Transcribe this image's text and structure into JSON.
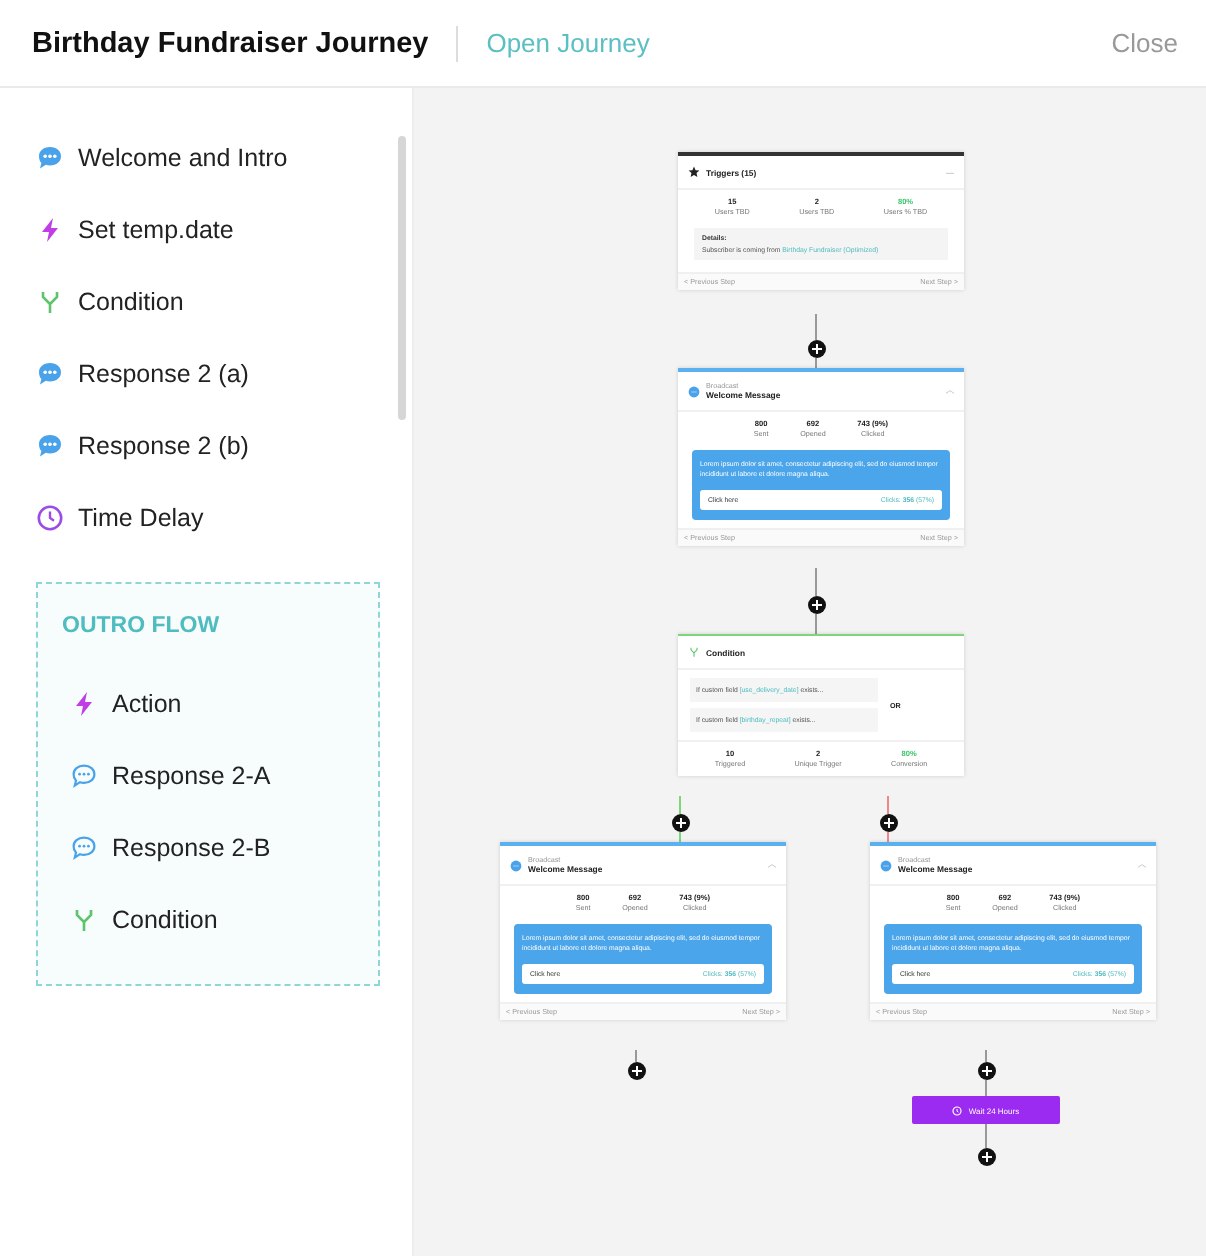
{
  "header": {
    "title": "Birthday Fundraiser Journey",
    "link": "Open Journey",
    "close": "Close"
  },
  "sidebar": {
    "items": [
      {
        "kind": "message",
        "label": "Welcome and Intro"
      },
      {
        "kind": "action",
        "label": "Set temp.date"
      },
      {
        "kind": "condition",
        "label": "Condition"
      },
      {
        "kind": "message",
        "label": "Response 2 (a)"
      },
      {
        "kind": "message",
        "label": "Response 2 (b)"
      },
      {
        "kind": "delay",
        "label": "Time Delay"
      }
    ],
    "outro": {
      "title": "OUTRO FLOW",
      "items": [
        {
          "kind": "action",
          "label": "Action"
        },
        {
          "kind": "response",
          "label": "Response 2-A"
        },
        {
          "kind": "response",
          "label": "Response 2-B"
        },
        {
          "kind": "condition",
          "label": "Condition"
        }
      ]
    }
  },
  "flow": {
    "steps": [
      {
        "kind": "trigger",
        "title": "Triggers (15)",
        "stats": [
          {
            "value": "15",
            "label": "Users TBD",
            "highlight": false
          },
          {
            "value": "2",
            "label": "Users TBD",
            "highlight": false
          },
          {
            "value": "80%",
            "label": "Users % TBD",
            "highlight": true
          }
        ],
        "details_label": "Details:",
        "details_text": "Subscriber is coming from",
        "details_link": "Birthday Fundraiser (Optimized)",
        "prev": "< Previous Step",
        "next": "Next Step >"
      },
      {
        "kind": "broadcast",
        "tag": "Broadcast",
        "title": "Welcome Message",
        "stats": [
          {
            "value": "800",
            "label": "Sent",
            "highlight": false
          },
          {
            "value": "692",
            "label": "Opened",
            "highlight": false
          },
          {
            "value": "743 (9%)",
            "label": "Clicked",
            "highlight": false
          }
        ],
        "message": "Lorem ipsum dolor sit amet, consectetur adipiscing elit, sed do eiusmod tempor incididunt ut labore et dolore magna aliqua.",
        "button": "Click here",
        "clicks": "Clicks: **356** (57%)",
        "prev": "< Previous Step",
        "next": "Next Step >"
      },
      {
        "kind": "condition",
        "title": "Condition",
        "rules": [
          {
            "text": "If custom field",
            "field": "[use_delivery_date]",
            "suffix": "exists..."
          },
          {
            "text": "If custom field",
            "field": "[birthday_repeat]",
            "suffix": "exists..."
          }
        ],
        "operator": "OR",
        "stats": [
          {
            "value": "10",
            "label": "Triggered",
            "highlight": false
          },
          {
            "value": "2",
            "label": "Unique Trigger",
            "highlight": false
          },
          {
            "value": "80%",
            "label": "Conversion",
            "highlight": true
          }
        ]
      },
      {
        "kind": "broadcast",
        "tag": "Broadcast",
        "title": "Welcome Message",
        "stats": [
          {
            "value": "800",
            "label": "Sent",
            "highlight": false
          },
          {
            "value": "692",
            "label": "Opened",
            "highlight": false
          },
          {
            "value": "743 (9%)",
            "label": "Clicked",
            "highlight": false
          }
        ],
        "message": "Lorem ipsum dolor sit amet, consectetur adipiscing elit, sed do eiusmod tempor incididunt ut labore et dolore magna aliqua.",
        "button": "Click here",
        "clicks": "Clicks: **356** (57%)",
        "prev": "< Previous Step",
        "next": "Next Step >"
      },
      {
        "kind": "broadcast",
        "tag": "Broadcast",
        "title": "Welcome Message",
        "stats": [
          {
            "value": "800",
            "label": "Sent",
            "highlight": false
          },
          {
            "value": "692",
            "label": "Opened",
            "highlight": false
          },
          {
            "value": "743 (9%)",
            "label": "Clicked",
            "highlight": false
          }
        ],
        "message": "Lorem ipsum dolor sit amet, consectetur adipiscing elit, sed do eiusmod tempor incididunt ut labore et dolore magna aliqua.",
        "button": "Click here",
        "clicks": "Clicks: **356** (57%)",
        "prev": "< Previous Step",
        "next": "Next Step >"
      },
      {
        "kind": "wait",
        "label": "Wait 24 Hours"
      }
    ]
  }
}
